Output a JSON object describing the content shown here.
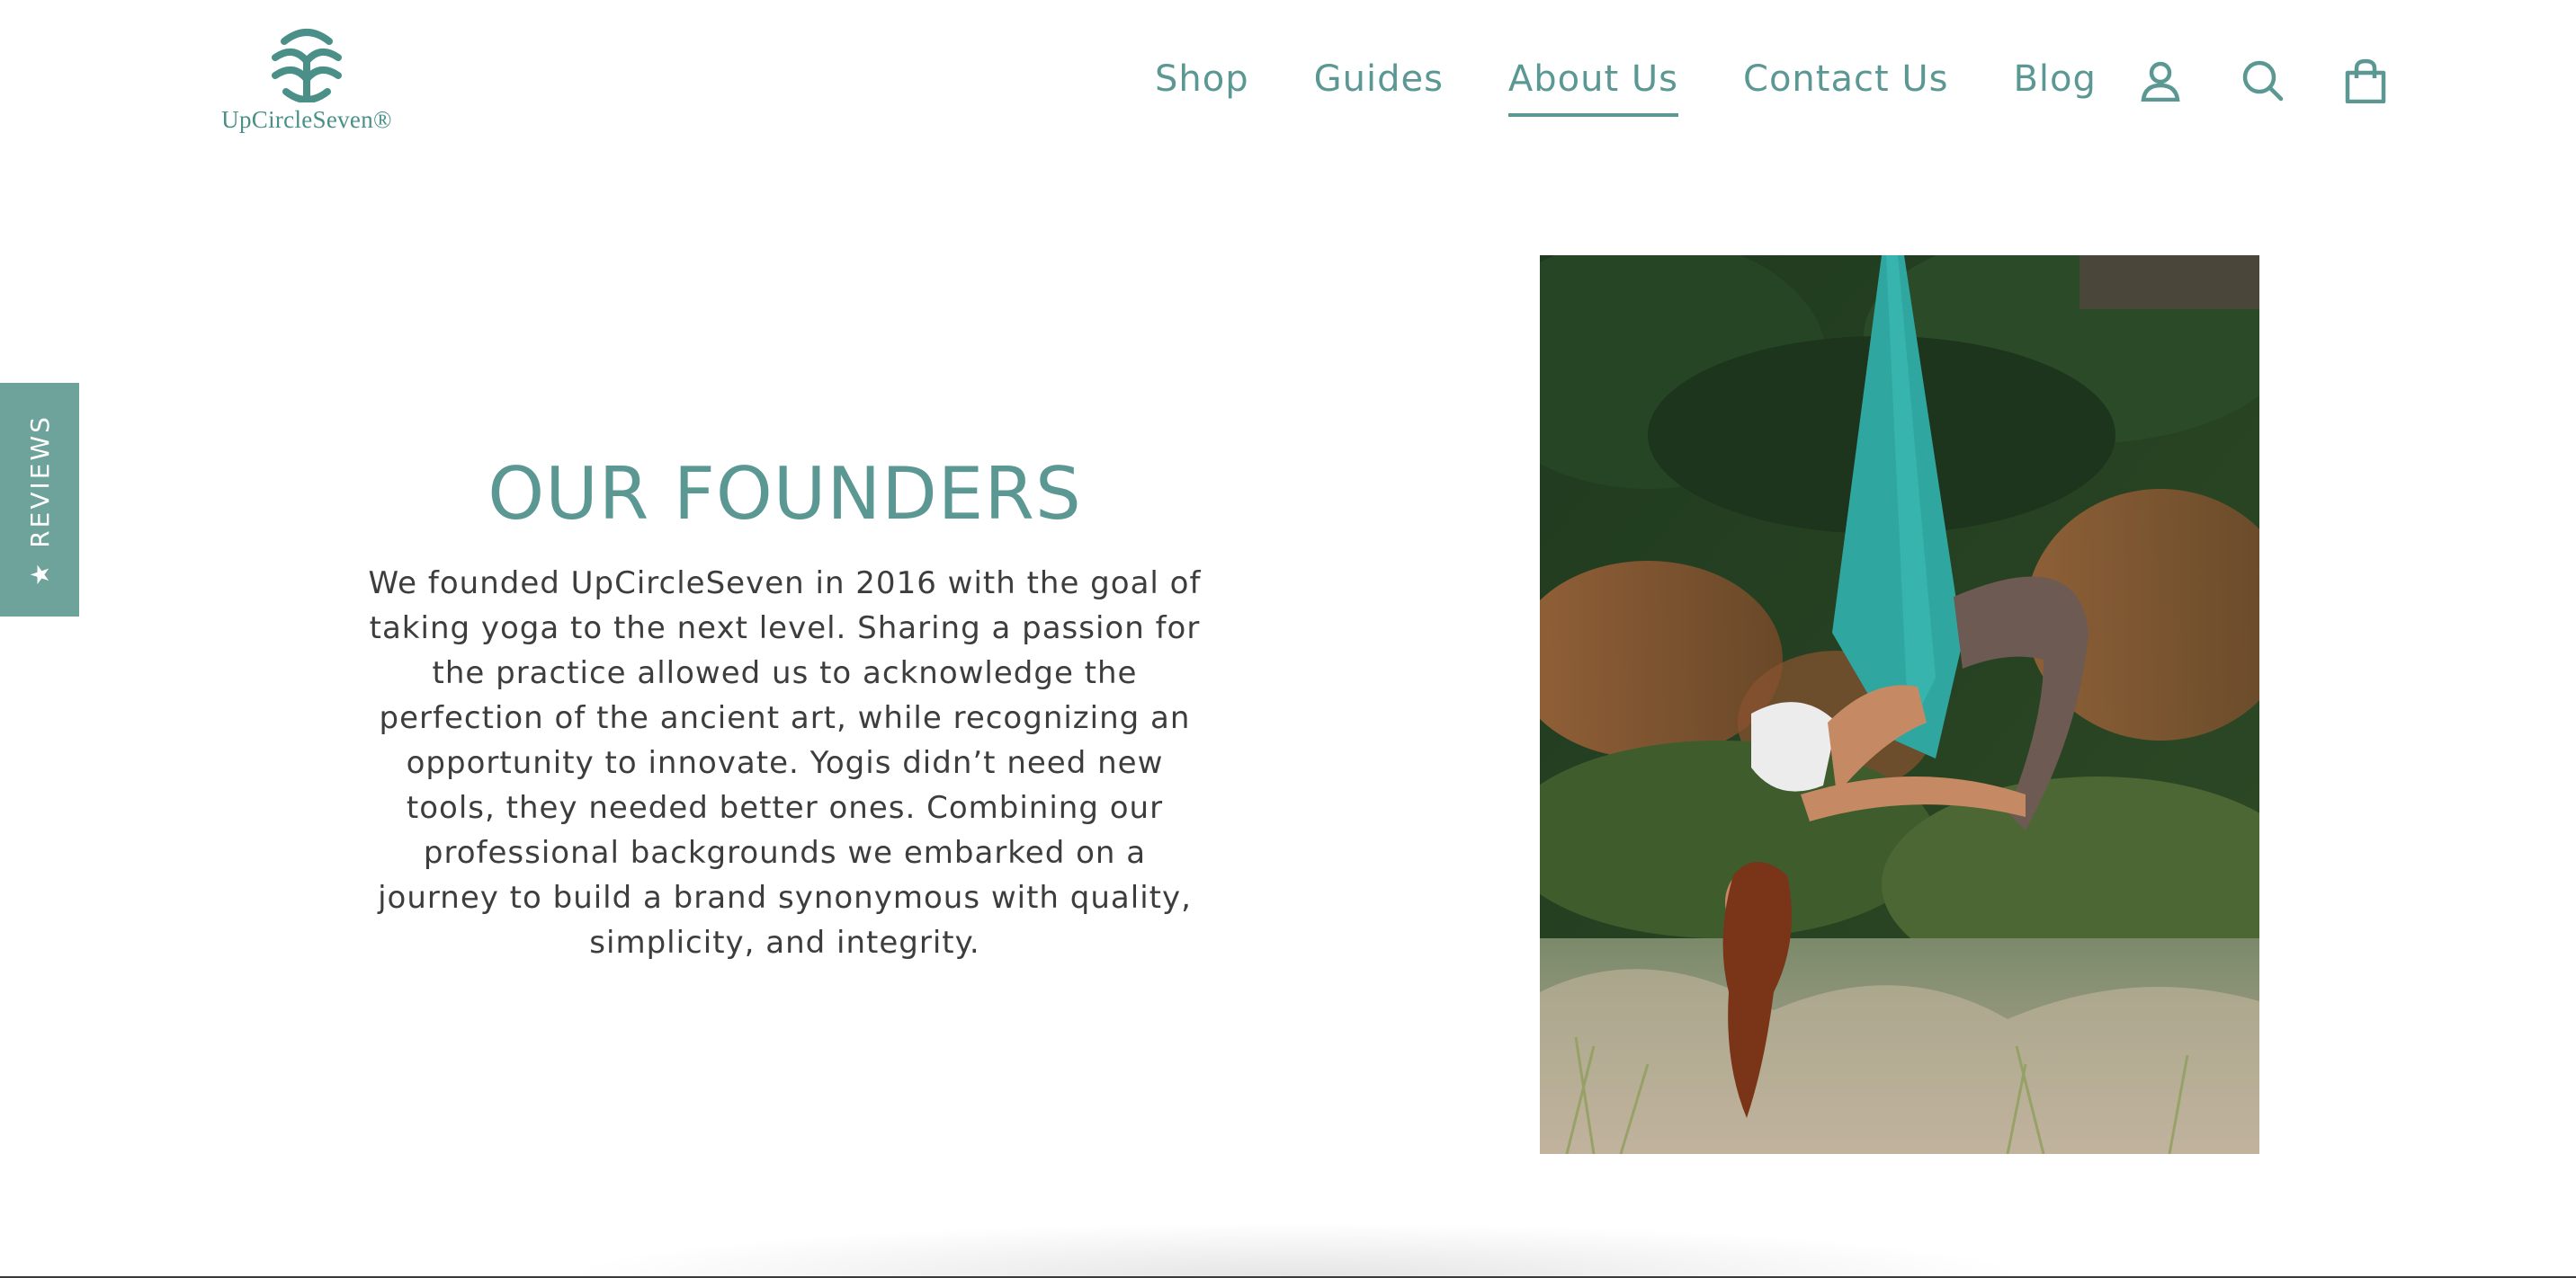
{
  "brand": {
    "name": "UpCircleSeven",
    "logo_text": "UpCircleSeven®"
  },
  "nav": {
    "items": [
      {
        "label": "Shop",
        "active": false
      },
      {
        "label": "Guides",
        "active": false
      },
      {
        "label": "About Us",
        "active": true
      },
      {
        "label": "Contact Us",
        "active": false
      },
      {
        "label": "Blog",
        "active": false
      }
    ],
    "icons": [
      "account-icon",
      "search-icon",
      "cart-icon"
    ]
  },
  "reviews_tab": {
    "label": "REVIEWS",
    "icon": "star-icon"
  },
  "founders": {
    "heading": "OUR FOUNDERS",
    "body": "We founded UpCircleSeven in 2016 with the goal of taking yoga to the next level. Sharing a passion for the practice allowed us to acknowledge the perfection of the ancient art, while recognizing an opportunity to innovate. Yogis didn’t need new tools, they needed better ones. Combining our professional backgrounds we embarked on a journey to build a brand synonymous with quality, simplicity, and integrity."
  },
  "image": {
    "subject": "woman-inverted-in-aerial-yoga-hammock"
  },
  "colors": {
    "brand_teal": "#5b9893",
    "tab_teal": "#6da39b",
    "hammock_teal": "#2fa7a0",
    "text_dark": "#3d3d3d"
  }
}
